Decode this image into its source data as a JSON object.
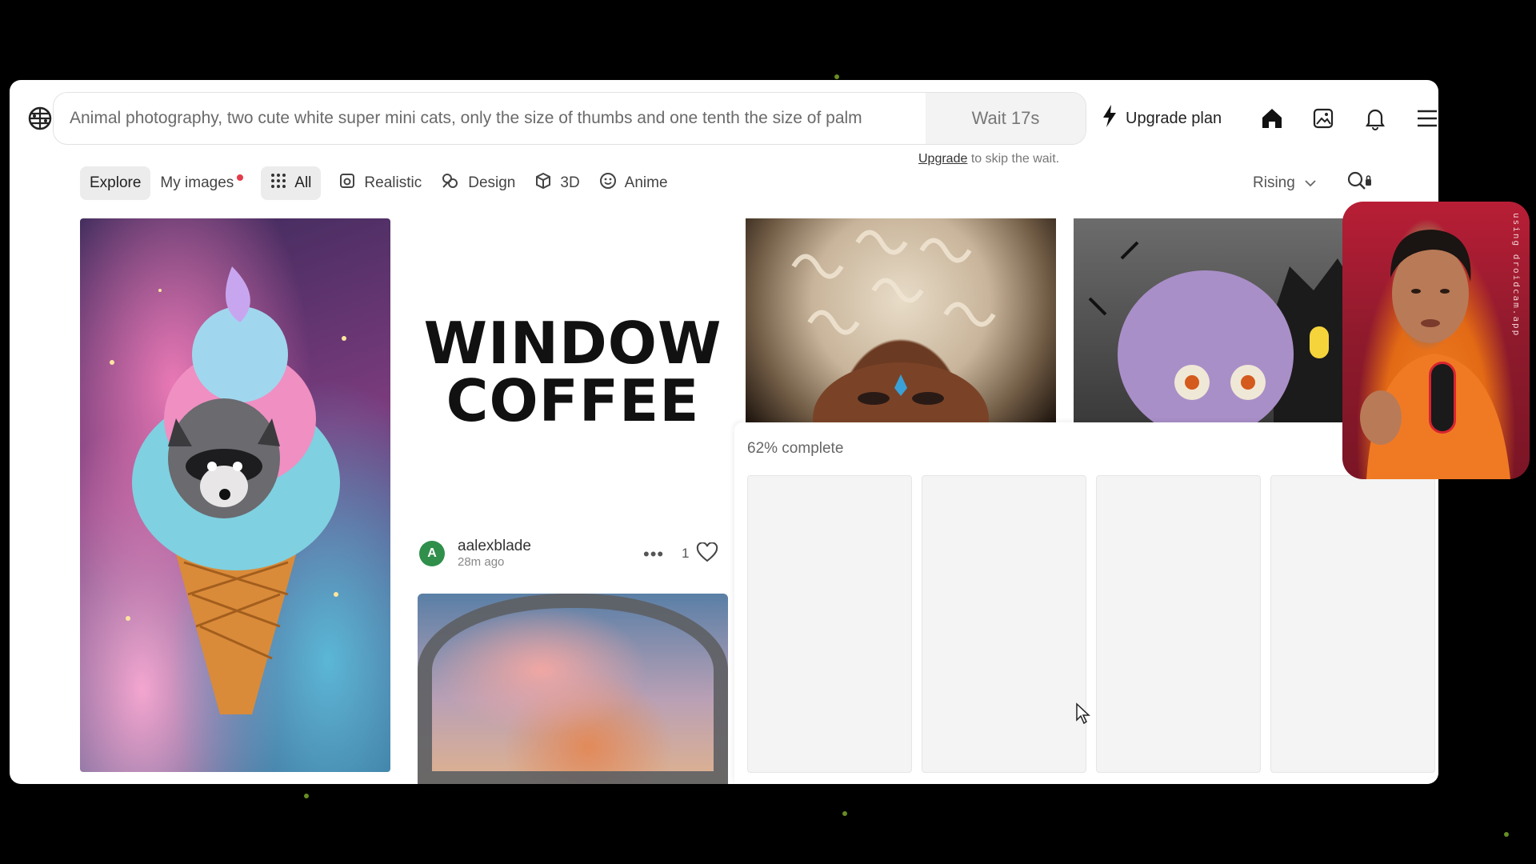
{
  "prompt": {
    "text": "Animal photography, two cute white super mini cats, only the size of thumbs and one tenth the size of palm",
    "wait_label": "Wait 17s"
  },
  "upgrade_note": {
    "link": "Upgrade",
    "rest": "to skip the wait."
  },
  "header": {
    "upgrade_plan_label": "Upgrade plan"
  },
  "tabs": {
    "explore": "Explore",
    "my_images": "My images",
    "all": "All",
    "realistic": "Realistic",
    "design": "Design",
    "threed": "3D",
    "anime": "Anime"
  },
  "sort": {
    "selected": "Rising"
  },
  "gallery": {
    "coffee_line1": "WINDOW",
    "coffee_line2": "COFFEE",
    "author": {
      "initial": "A",
      "name": "aalexblade",
      "time": "28m ago",
      "likes": "1"
    }
  },
  "generation": {
    "progress_text": "62% complete",
    "progress": 0.62
  },
  "webcam": {
    "watermark": "using droidcam.app"
  },
  "colors": {
    "accent_red": "#e43b4b",
    "avatar_green": "#2f8f4b"
  }
}
